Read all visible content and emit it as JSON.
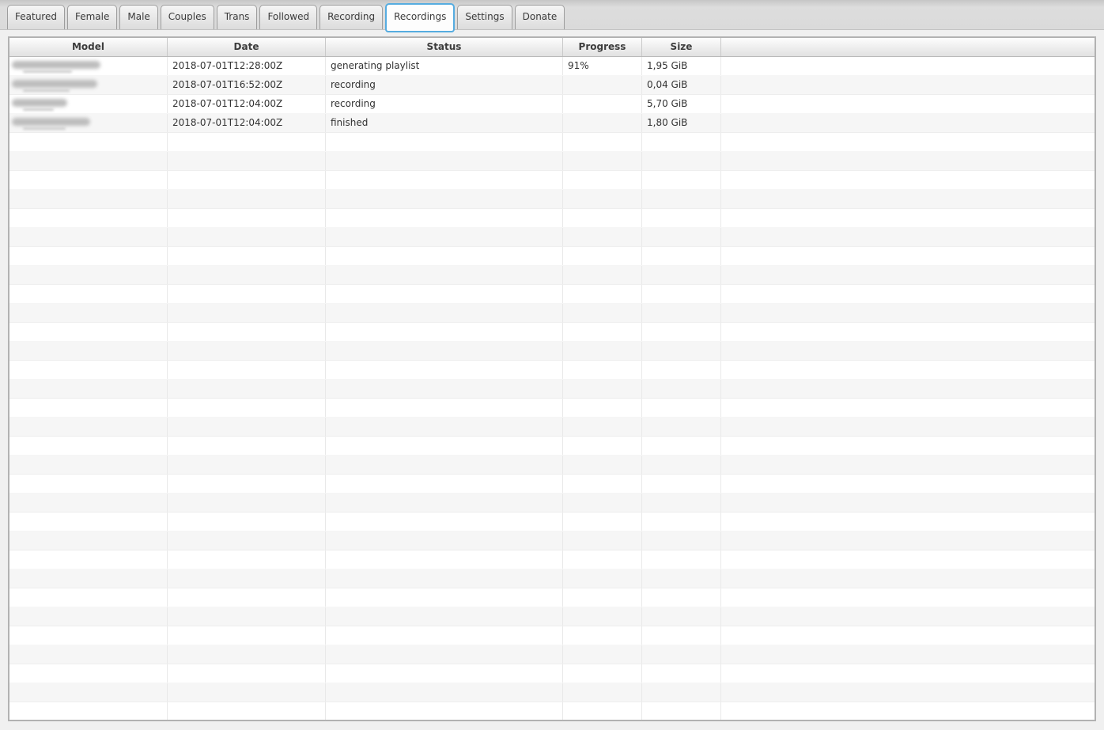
{
  "tabs": [
    {
      "label": "Featured",
      "selected": false
    },
    {
      "label": "Female",
      "selected": false
    },
    {
      "label": "Male",
      "selected": false
    },
    {
      "label": "Couples",
      "selected": false
    },
    {
      "label": "Trans",
      "selected": false
    },
    {
      "label": "Followed",
      "selected": false
    },
    {
      "label": "Recording",
      "selected": false
    },
    {
      "label": "Recordings",
      "selected": true
    },
    {
      "label": "Settings",
      "selected": false
    },
    {
      "label": "Donate",
      "selected": false
    }
  ],
  "table": {
    "columns": [
      "Model",
      "Date",
      "Status",
      "Progress",
      "Size"
    ],
    "rows": [
      {
        "model_redacted": true,
        "redaction_width": 112,
        "date": "2018-07-01T12:28:00Z",
        "status": "generating playlist",
        "progress": "91%",
        "size": "1,95 GiB"
      },
      {
        "model_redacted": true,
        "redaction_width": 108,
        "date": "2018-07-01T16:52:00Z",
        "status": "recording",
        "progress": "",
        "size": "0,04 GiB"
      },
      {
        "model_redacted": true,
        "redaction_width": 70,
        "date": "2018-07-01T12:04:00Z",
        "status": "recording",
        "progress": "",
        "size": "5,70 GiB"
      },
      {
        "model_redacted": true,
        "redaction_width": 99,
        "date": "2018-07-01T12:04:00Z",
        "status": "finished",
        "progress": "",
        "size": "1,80 GiB"
      }
    ],
    "empty_row_count": 31
  },
  "colors": {
    "accent_blue": "#56ace0",
    "window_bg": "#f0f0f0",
    "tabstrip_bg": "#dadada",
    "stripe": "#f6f6f6",
    "table_border": "#b2b2b2"
  }
}
